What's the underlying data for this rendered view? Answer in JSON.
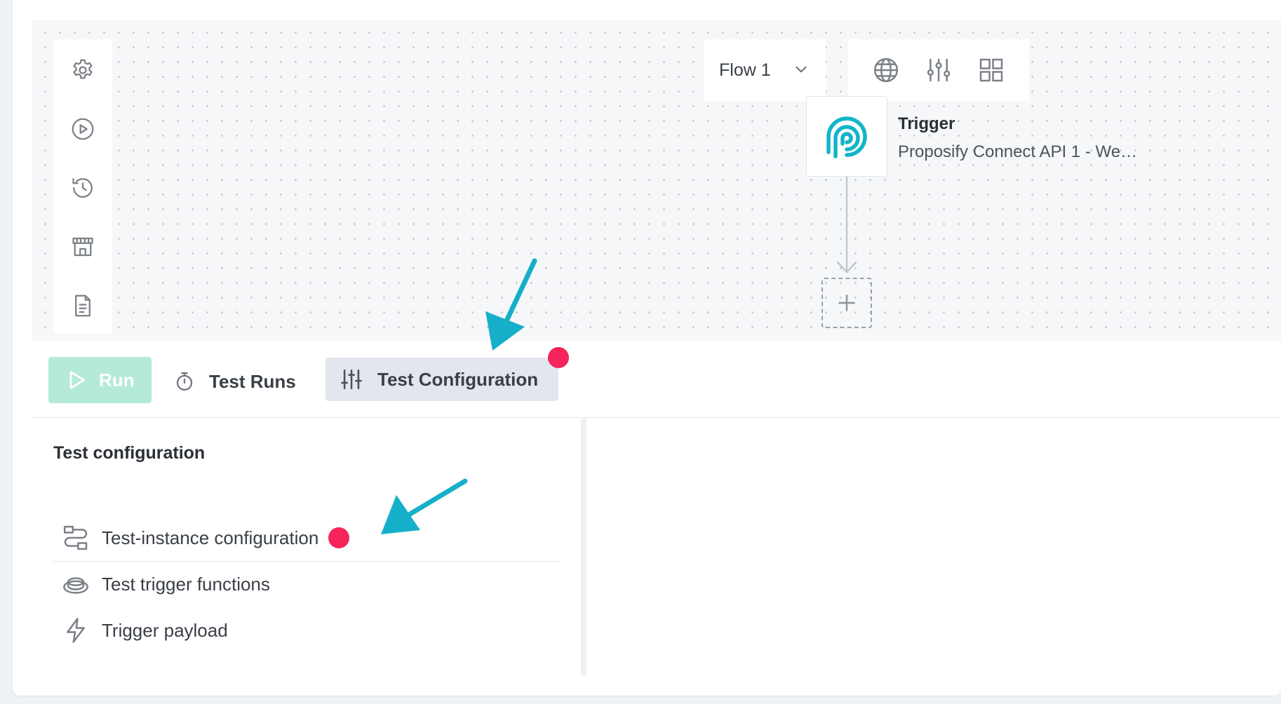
{
  "rail": {
    "items": [
      {
        "icon": "gear-icon"
      },
      {
        "icon": "play-circle-icon"
      },
      {
        "icon": "history-icon"
      },
      {
        "icon": "marketplace-icon"
      },
      {
        "icon": "document-icon"
      }
    ]
  },
  "header": {
    "flow_selector": {
      "value": "Flow 1"
    },
    "tools": [
      "globe-icon",
      "sliders-icon",
      "grid-icon"
    ]
  },
  "trigger": {
    "title": "Trigger",
    "subtitle": "Proposify Connect API 1 - We…",
    "logo": "proposify-logo-icon",
    "accent": "#12b5c8"
  },
  "toolbar": {
    "run_label": "Run",
    "test_runs_label": "Test Runs",
    "test_config_label": "Test Configuration"
  },
  "panel": {
    "title": "Test configuration",
    "items": [
      {
        "label": "Test-instance configuration",
        "icon": "route-icon",
        "has_alert": true
      },
      {
        "label": "Test trigger functions",
        "icon": "push-button-icon",
        "has_alert": false
      },
      {
        "label": "Trigger payload",
        "icon": "lightning-icon",
        "has_alert": false
      }
    ]
  },
  "colors": {
    "run_button": "#b5ead9",
    "alert_dot": "#f5245a",
    "annotation_arrow": "#16afc9"
  }
}
